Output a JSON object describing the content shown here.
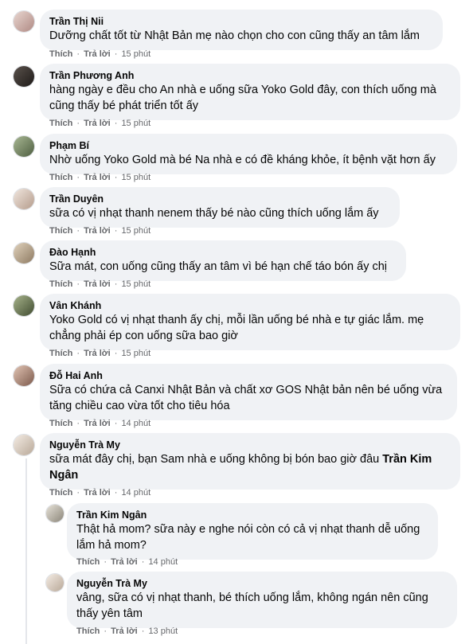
{
  "actions": {
    "like": "Thích",
    "reply": "Trả lời",
    "separator": "·"
  },
  "comments": [
    {
      "author": "Trần Thị Nii",
      "text": "Dưỡng chất tốt từ Nhật Bản mẹ nào chọn cho con cũng thấy an tâm lắm",
      "time": "15 phút",
      "avatar_color": "#c9a7a3"
    },
    {
      "author": "Trần Phương Anh",
      "text": "hàng ngày e đều cho An nhà e uống sữa Yoko Gold đây, con thích uống mà cũng thấy bé phát triển tốt ấy",
      "time": "15 phút",
      "avatar_color": "#3a3430"
    },
    {
      "author": "Phạm Bí",
      "text": "Nhờ uống Yoko Gold mà bé Na nhà e có đề kháng khỏe, ít bệnh vặt hơn ấy",
      "time": "15 phút",
      "avatar_color": "#7a8f6a"
    },
    {
      "author": "Trần Duyên",
      "text": "sữa có vị nhạt thanh nenem thấy bé nào cũng thích uống lắm ấy",
      "time": "15 phút",
      "avatar_color": "#d8c8bc"
    },
    {
      "author": "Đào Hạnh",
      "text": "Sữa mát, con uống cũng thấy an tâm vì bé hạn chế táo bón ấy chị",
      "time": "15 phút",
      "avatar_color": "#b8a48c"
    },
    {
      "author": "Vân Khánh",
      "text": "Yoko Gold có vị nhạt thanh ấy chị, mỗi lần uống bé nhà e tự giác lắm. mẹ chẳng phải ép con uống sữa bao giờ",
      "time": "15 phút",
      "avatar_color": "#6d7a55"
    },
    {
      "author": "Đỗ Hai Anh",
      "text": "Sữa có chứa cả Canxi Nhật Bản và chất xơ GOS Nhật bản nên bé uống vừa tăng chiều cao vừa tốt cho tiêu hóa",
      "time": "14 phút",
      "avatar_color": "#a88a7c"
    },
    {
      "author": "Nguyễn Trà My",
      "text": "sữa mát đây chị, bạn Sam nhà e uống không bị bón bao giờ đâu ",
      "mention": "Trần Kim Ngân",
      "time": "14 phút",
      "avatar_color": "#d9cfc4"
    }
  ],
  "replies": [
    {
      "author": "Trần Kim Ngân",
      "text": "Thật hả mom? sữa này e nghe nói còn có cả vị nhạt thanh dễ uống lắm hả mom?",
      "time": "14 phút",
      "avatar_color": "#b9b4a8"
    },
    {
      "author": "Nguyễn Trà My",
      "text": "vâng, sữa có vị nhạt thanh, bé thích uống lắm, không ngán nên cũng thấy yên tâm",
      "time": "13 phút",
      "avatar_color": "#d9cfc4"
    }
  ]
}
